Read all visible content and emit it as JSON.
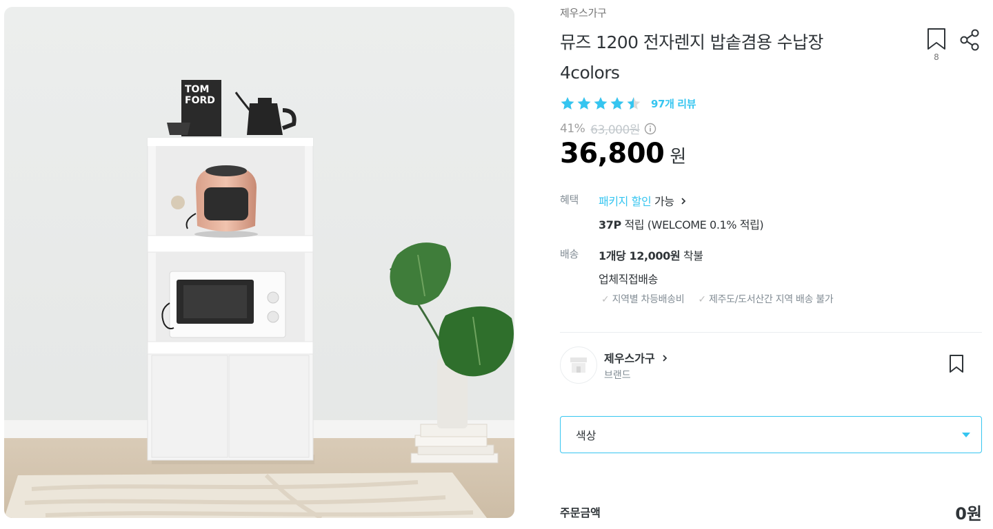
{
  "product": {
    "brand": "제우스가구",
    "title_line1": "뮤즈 1200 전자렌지 밥솥겸용 수납장",
    "title_line2": "4colors",
    "scrap_count": "8",
    "rating": 4.5,
    "review_link": "97개 리뷰",
    "discount_rate": "41%",
    "original_price": "63,000원",
    "sale_price": "36,800",
    "price_unit": "원",
    "image_box_text": "TOM\nFORD"
  },
  "benefit": {
    "label": "혜택",
    "package_link": "패키지 할인",
    "available": "가능",
    "points_bold": "37P",
    "points_text": "적립 (WELCOME 0.1% 적립)"
  },
  "shipping": {
    "label": "배송",
    "fee_bold": "1개당 12,000원",
    "fee_suffix": "착불",
    "method": "업체직접배송",
    "notes": [
      "지역별 차등배송비",
      "제주도/도서산간 지역 배송 불가"
    ]
  },
  "brand_card": {
    "name": "제우스가구",
    "sub": "브랜드"
  },
  "option": {
    "color_label": "색상"
  },
  "order": {
    "label": "주문금액",
    "amount": "0원"
  },
  "colors": {
    "accent": "#35c5f0",
    "text": "#2f3438",
    "muted": "#828c94"
  },
  "icons": [
    "bookmark-icon",
    "share-icon",
    "star-icon",
    "info-icon",
    "chevron-right-icon",
    "store-icon",
    "caret-down-icon"
  ]
}
